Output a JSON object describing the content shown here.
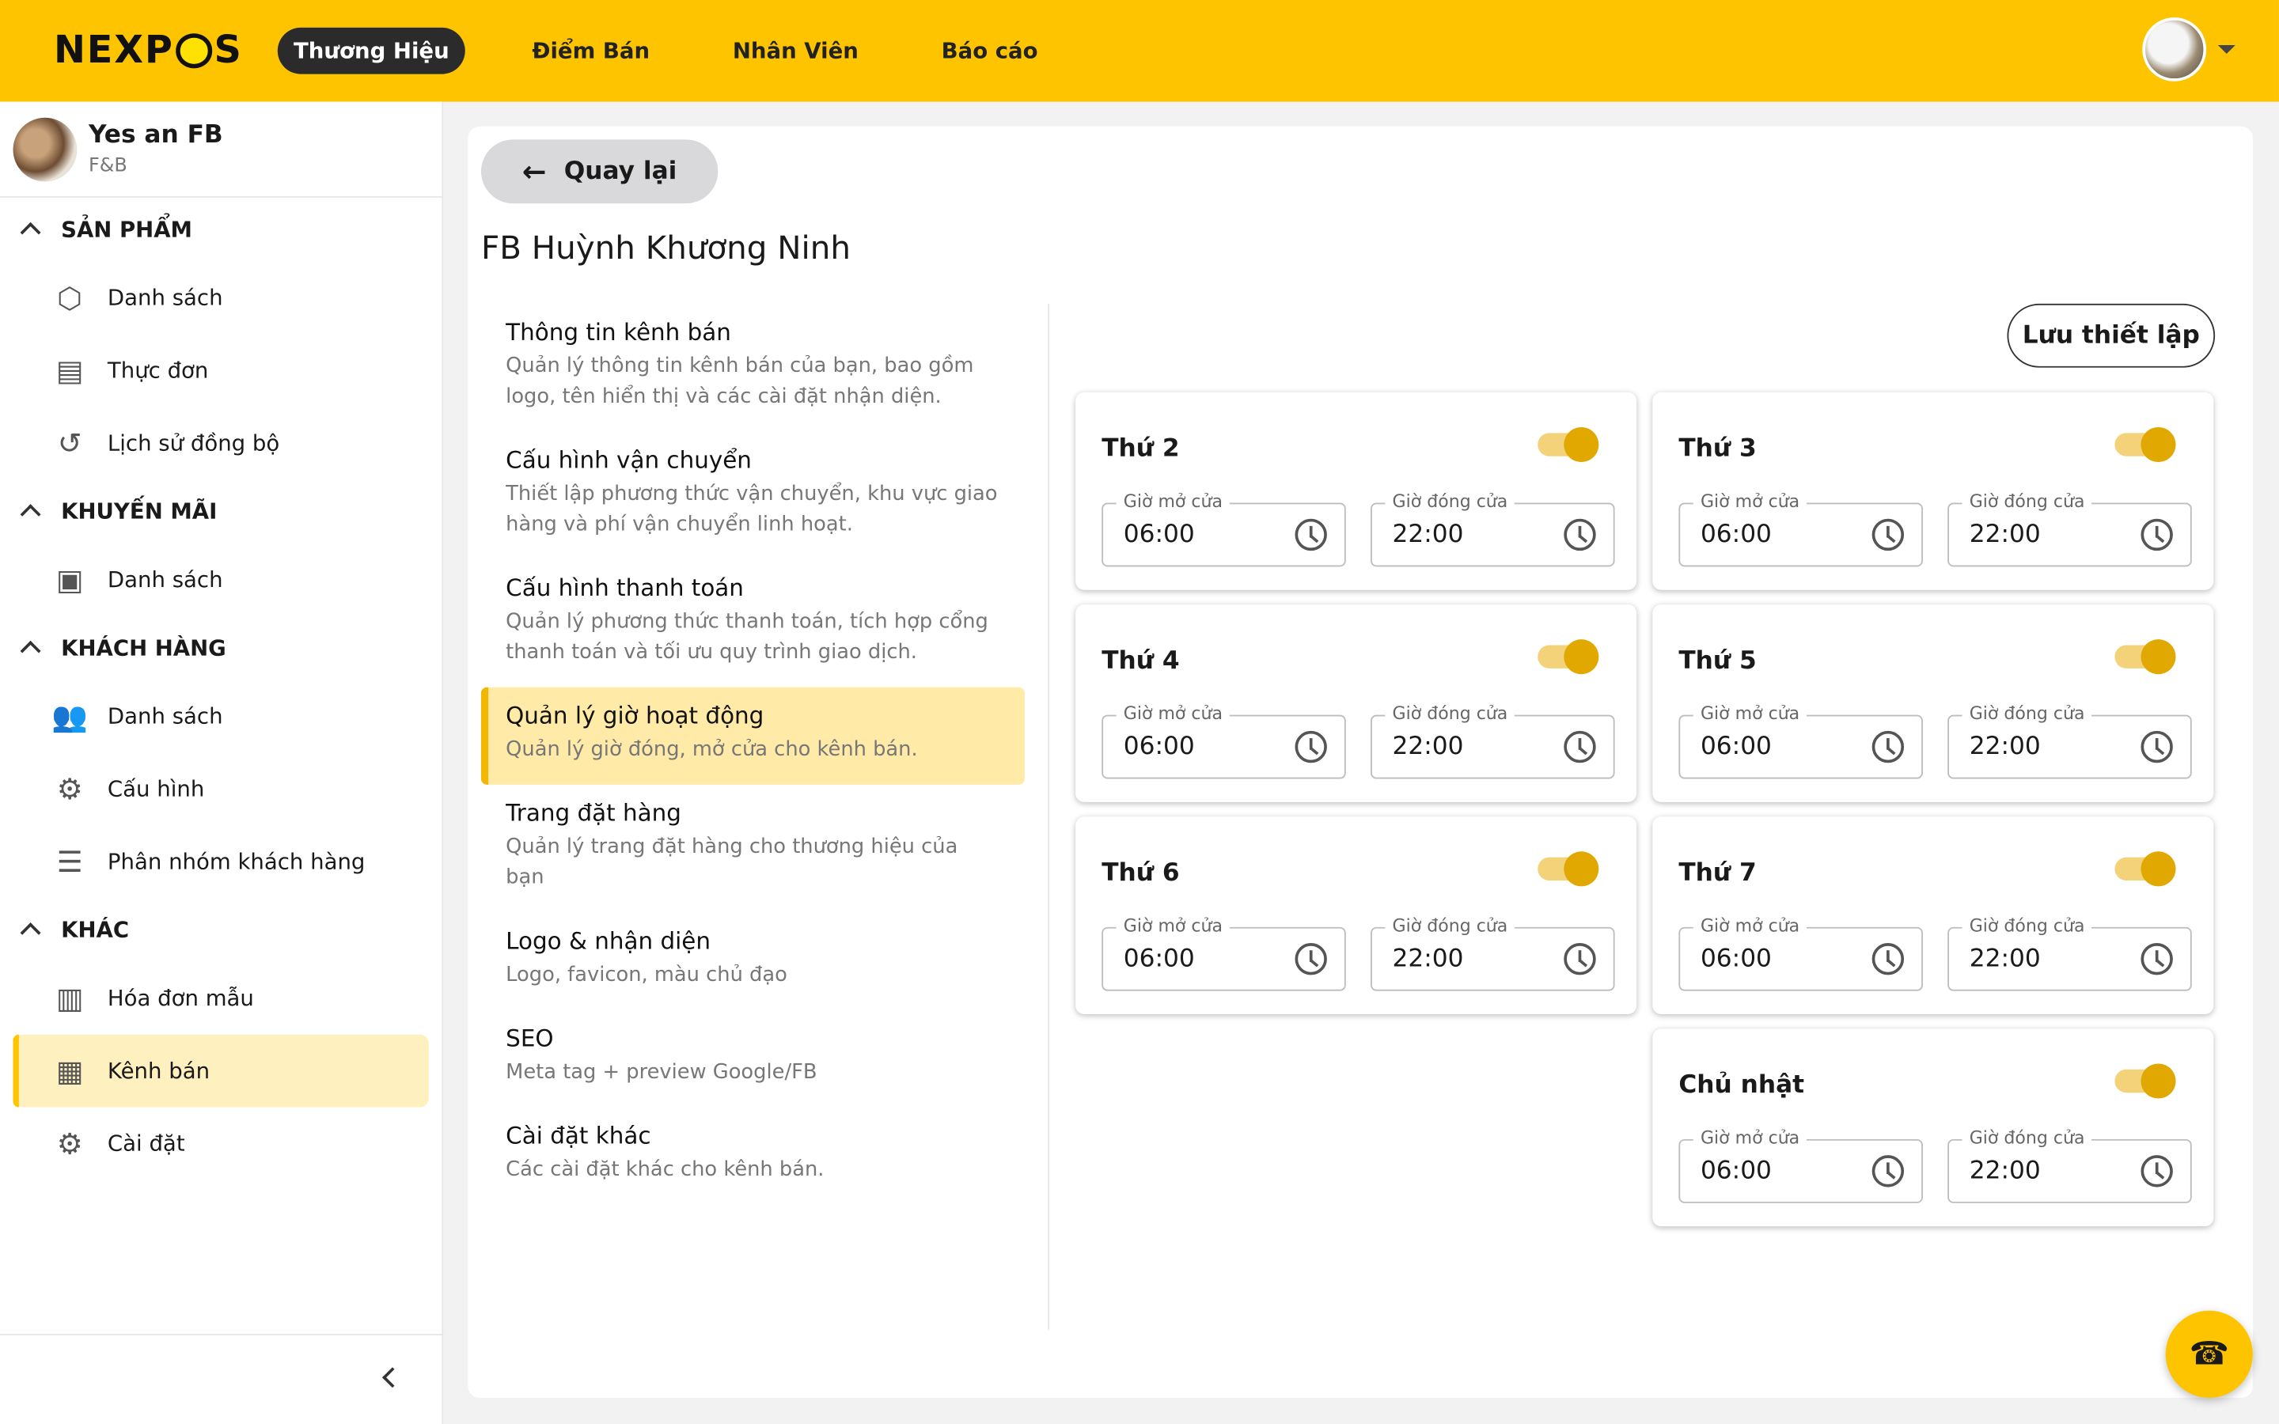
{
  "app": {
    "logo_text": "NEXPOS",
    "accent_color": "#ffc400"
  },
  "topnav": [
    {
      "label": "Thương Hiệu",
      "active": true
    },
    {
      "label": "Điểm Bán",
      "active": false
    },
    {
      "label": "Nhân Viên",
      "active": false
    },
    {
      "label": "Báo cáo",
      "active": false
    }
  ],
  "brand": {
    "name": "Yes an FB",
    "subtitle": "F&B"
  },
  "sidebar": {
    "sections": [
      {
        "title": "SẢN PHẨM",
        "items": [
          {
            "label": "Danh sách",
            "icon": "cube-icon"
          },
          {
            "label": "Thực đơn",
            "icon": "menu-book-icon"
          },
          {
            "label": "Lịch sử đồng bộ",
            "icon": "history-icon"
          }
        ]
      },
      {
        "title": "KHUYẾN MÃI",
        "items": [
          {
            "label": "Danh sách",
            "icon": "gift-card-icon"
          }
        ]
      },
      {
        "title": "KHÁCH HÀNG",
        "items": [
          {
            "label": "Danh sách",
            "icon": "people-icon"
          },
          {
            "label": "Cấu hình",
            "icon": "gear-icon"
          },
          {
            "label": "Phân nhóm khách hàng",
            "icon": "list-icon"
          }
        ]
      },
      {
        "title": "KHÁC",
        "items": [
          {
            "label": "Hóa đơn mẫu",
            "icon": "receipt-icon"
          },
          {
            "label": "Kênh bán",
            "icon": "store-icon",
            "active": true
          },
          {
            "label": "Cài đặt",
            "icon": "gear-icon"
          }
        ]
      }
    ]
  },
  "main": {
    "back_label": "Quay lại",
    "title": "FB Huỳnh Khương Ninh",
    "save_label": "Lưu thiết lập",
    "menu": [
      {
        "title": "Thông tin kênh bán",
        "desc": "Quản lý thông tin kênh bán của bạn, bao gồm logo, tên hiển thị và các cài đặt nhận diện."
      },
      {
        "title": "Cấu hình vận chuyển",
        "desc": "Thiết lập phương thức vận chuyển, khu vực giao hàng và phí vận chuyển linh hoạt."
      },
      {
        "title": "Cấu hình thanh toán",
        "desc": "Quản lý phương thức thanh toán, tích hợp cổng thanh toán và tối ưu quy trình giao dịch."
      },
      {
        "title": "Quản lý giờ hoạt động",
        "desc": "Quản lý giờ đóng, mở cửa cho kênh bán.",
        "active": true
      },
      {
        "title": "Trang đặt hàng",
        "desc": "Quản lý trang đặt hàng cho thương hiệu của bạn"
      },
      {
        "title": "Logo & nhận diện",
        "desc": "Logo, favicon, màu chủ đạo"
      },
      {
        "title": "SEO",
        "desc": "Meta tag + preview Google/FB"
      },
      {
        "title": "Cài đặt khác",
        "desc": "Các cài đặt khác cho kênh bán."
      }
    ],
    "open_label": "Giờ mở cửa",
    "close_label": "Giờ đóng cửa",
    "days": [
      {
        "name": "Thứ 2",
        "enabled": true,
        "open": "06:00",
        "close": "22:00"
      },
      {
        "name": "Thứ 3",
        "enabled": true,
        "open": "06:00",
        "close": "22:00"
      },
      {
        "name": "Thứ 4",
        "enabled": true,
        "open": "06:00",
        "close": "22:00"
      },
      {
        "name": "Thứ 5",
        "enabled": true,
        "open": "06:00",
        "close": "22:00"
      },
      {
        "name": "Thứ 6",
        "enabled": true,
        "open": "06:00",
        "close": "22:00"
      },
      {
        "name": "Thứ 7",
        "enabled": true,
        "open": "06:00",
        "close": "22:00"
      },
      {
        "name": "Chủ nhật",
        "enabled": true,
        "open": "06:00",
        "close": "22:00"
      }
    ]
  }
}
